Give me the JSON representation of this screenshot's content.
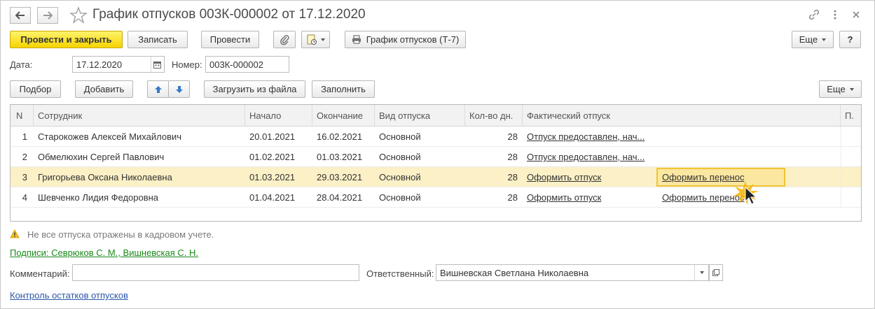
{
  "window": {
    "title": "График отпусков 003К-000002 от 17.12.2020",
    "icons": [
      "back-arrow-icon",
      "forward-arrow-icon",
      "favorite-star-icon",
      "link-icon",
      "more-vert-icon",
      "close-icon"
    ]
  },
  "toolbar": {
    "post_close": "Провести и закрыть",
    "save": "Записать",
    "post": "Провести",
    "print_t7": "График отпусков (Т-7)",
    "more": "Еще",
    "help": "?"
  },
  "header": {
    "date_label": "Дата:",
    "date_value": "17.12.2020",
    "number_label": "Номер:",
    "number_value": "003К-000002"
  },
  "table_toolbar": {
    "select": "Подбор",
    "add": "Добавить",
    "load": "Загрузить из файла",
    "fill": "Заполнить",
    "more": "Еще"
  },
  "table": {
    "columns": [
      "N",
      "Сотрудник",
      "Начало",
      "Окончание",
      "Вид отпуска",
      "Кол-во дн.",
      "Фактический отпуск",
      "П."
    ],
    "rows": [
      {
        "n": "1",
        "employee": "Старокожев Алексей Михайлович",
        "start": "20.01.2021",
        "end": "16.02.2021",
        "type": "Основной",
        "days": "28",
        "actual": "Отпуск предоставлен, нач...",
        "transfer": ""
      },
      {
        "n": "2",
        "employee": "Обмелюхин Сергей Павлович",
        "start": "01.02.2021",
        "end": "01.03.2021",
        "type": "Основной",
        "days": "28",
        "actual": "Отпуск предоставлен, нач...",
        "transfer": ""
      },
      {
        "n": "3",
        "employee": "Григорьева Оксана Николаевна",
        "start": "01.03.2021",
        "end": "29.03.2021",
        "type": "Основной",
        "days": "28",
        "actual": "Оформить отпуск",
        "transfer": "Оформить перенос"
      },
      {
        "n": "4",
        "employee": "Шевченко Лидия Федоровна",
        "start": "01.04.2021",
        "end": "28.04.2021",
        "type": "Основной",
        "days": "28",
        "actual": "Оформить отпуск",
        "transfer": "Оформить перенос"
      }
    ],
    "selected_row": 2
  },
  "footer": {
    "warning": "Не все отпуска отражены в кадровом учете.",
    "signatures": "Подписи: Севрюков С. М., Вишневская С. Н.",
    "comment_label": "Комментарий:",
    "comment_value": "",
    "responsible_label": "Ответственный:",
    "responsible_value": "Вишневская Светлана Николаевна",
    "balance_link": "Контроль остатков отпусков"
  },
  "colors": {
    "primary_button": "#f5d400",
    "selected_row": "#fbf0c6",
    "signature_link": "#1a8a1a",
    "balance_link": "#2b56a8",
    "warning": "#e0b000"
  }
}
